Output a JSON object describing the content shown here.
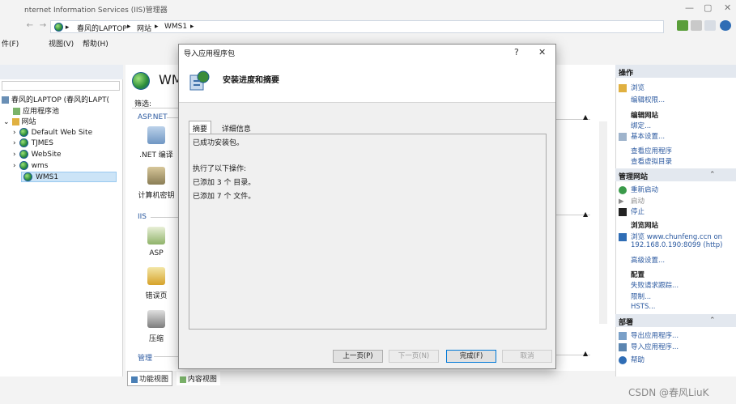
{
  "window": {
    "title": "nternet Information Services (IIS)管理器",
    "controls": [
      "—",
      "▢",
      "✕"
    ]
  },
  "address": {
    "crumbs": [
      "春风的LAPTOP",
      "网站",
      "WMS1"
    ]
  },
  "menu": [
    "件(F)",
    "视图(V)",
    "帮助(H)"
  ],
  "tree": {
    "items": [
      {
        "label": "春风的LAPTOP (春风的LAPT(",
        "indent": 0
      },
      {
        "label": "应用程序池",
        "indent": 1
      },
      {
        "label": "网站",
        "indent": 0
      },
      {
        "label": "Default Web Site",
        "indent": 2
      },
      {
        "label": "TJMES",
        "indent": 2
      },
      {
        "label": "WebSite",
        "indent": 2
      },
      {
        "label": "wms",
        "indent": 2
      },
      {
        "label": "WMS1",
        "indent": 2,
        "selected": true
      }
    ]
  },
  "main": {
    "title": "WM",
    "filter_label": "筛选:",
    "section_aspnet": "ASP.NET",
    "section_iis": "IIS",
    "section_manage": "管理",
    "features": [
      ".NET 编译",
      "计算机密钥",
      "ASP",
      "错误页",
      "压缩"
    ],
    "net_fragment": ".",
    "key_fragment": "."
  },
  "bottom_tabs": [
    "功能视图",
    "内容视图"
  ],
  "dialog": {
    "title": "导入应用程序包",
    "question": "?",
    "close": "✕",
    "heading": "安装进度和摘要",
    "tabs": [
      "摘要",
      "详细信息"
    ],
    "lines": [
      "已成功安装包。",
      "",
      "执行了以下操作:",
      "已添加 3 个 目录。",
      "已添加 7 个 文件。"
    ],
    "buttons": {
      "prev": "上一页(P)",
      "next": "下一页(N)",
      "finish": "完成(F)",
      "cancel": "取消"
    }
  },
  "actions": {
    "header": "操作",
    "browse": "浏览",
    "edit_permissions": "编辑权限...",
    "edit_site_header": "编辑网站",
    "bindings": "绑定...",
    "basic_settings": "基本设置...",
    "view_apps": "查看应用程序",
    "view_vdirs": "查看虚拟目录",
    "manage_site_header": "管理网站",
    "restart": "重新启动",
    "start": "启动",
    "stop": "停止",
    "browse_site_header": "浏览网站",
    "browse_url1": "浏览 www.chunfeng.ccn on",
    "browse_url2": "192.168.0.190:8099 (http)",
    "advanced": "高级设置...",
    "configure_header": "配置",
    "failed_trace": "失败请求跟踪...",
    "limits": "限制...",
    "hsts": "HSTS...",
    "deploy_header": "部署",
    "export_app": "导出应用程序...",
    "import_app": "导入应用程序...",
    "help": "帮助"
  },
  "watermark": "CSDN @春风LiuK",
  "colors": {
    "accent": "#0078d7",
    "link": "#2c5aa0"
  }
}
